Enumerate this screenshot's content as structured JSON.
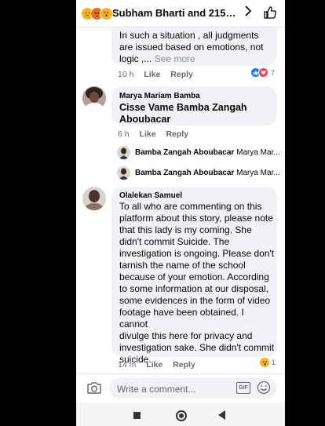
{
  "header": {
    "title": "Subham Bharti and 215 othe...",
    "reactions": [
      "sad-emoji",
      "angry-emoji",
      "wow-emoji"
    ],
    "chevron": "chevron-right-icon",
    "like_icon": "thumbs-up-icon"
  },
  "comments": [
    {
      "text_lines": [
        "In such a situation , all judgments",
        "are issued based on emotions, not",
        "logic ,..."
      ],
      "see_more": "See more",
      "time": "10 h",
      "like": "Like",
      "reply": "Reply",
      "reaction_count": "7"
    },
    {
      "author": "Marya Mariam Bamba",
      "text_lines": [
        "Cisse Vame Bamba Zangah",
        "Aboubacar"
      ],
      "time": "6 h",
      "like": "Like",
      "reply": "Reply",
      "replies": [
        {
          "author": "Bamba Zangah Aboubacar",
          "preview": "Marya Mar..."
        },
        {
          "author": "Bamba Zangah Aboubacar",
          "preview": "Marya Mar..."
        }
      ]
    },
    {
      "author": "Olalekan Samuel",
      "text_lines": [
        "To all who are commenting on this",
        "platform about this story, please note",
        "that this lady is my coming. She",
        "didn't commit Suicide. The",
        "investigation is ongoing. Please don't",
        "tarnish the name of the school",
        "because of your emotion. According",
        "to some information at our disposal,",
        "some evidences in the form of video",
        "footage have been obtained. I cannot",
        "divulge this here for privacy and",
        "investigation sake. She didn't commit",
        "suicide."
      ],
      "time": "14 m",
      "like": "Like",
      "reply": "Reply",
      "reaction_count": "1"
    }
  ],
  "composer": {
    "placeholder": "Write a comment...",
    "gif_label": "GIF"
  },
  "colors": {
    "bubble": "#f0f2f5",
    "text": "#050505",
    "muted": "#65676b",
    "like_blue": "#1877f2",
    "love_red": "#f33e58"
  }
}
